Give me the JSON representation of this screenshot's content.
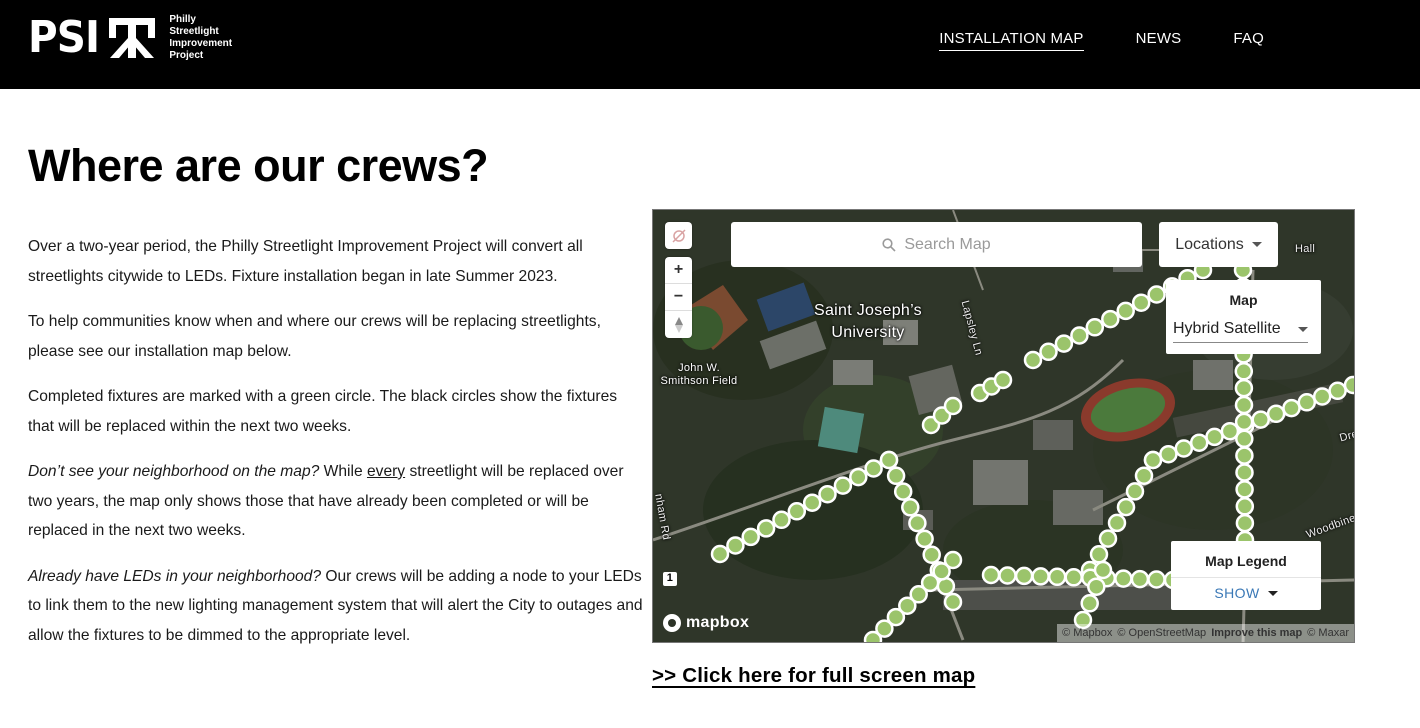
{
  "header": {
    "logo_letters": "PSI",
    "logo_subtitle": [
      "Philly",
      "Streetlight",
      "Improvement",
      "Project"
    ],
    "nav": [
      {
        "label": "INSTALLATION MAP",
        "active": true
      },
      {
        "label": "NEWS",
        "active": false
      },
      {
        "label": "FAQ",
        "active": false
      }
    ]
  },
  "page": {
    "title": "Where are our crews?",
    "paragraphs": {
      "p1": "Over a two-year period, the Philly Streetlight Improvement Project will convert all streetlights citywide to LEDs.  Fixture installation began in late Summer 2023.",
      "p2": "To help communities know when and where our crews will be replacing streetlights, please see our installation map below.",
      "p3": "Completed fixtures are marked with a green circle. The black circles show the fixtures that will be replaced within the next two weeks.",
      "p4_em": "Don’t see your neighborhood on the map?",
      "p4_a": " While ",
      "p4_u": "every",
      "p4_b": " streetlight will be replaced over two years, the map only shows those that have already been completed or will be replaced in the next two weeks.",
      "p5_em": "Already have LEDs in your neighborhood?",
      "p5_b": " Our crews will be adding a node to your LEDs to link them to the new lighting management system that will alert the City to outages and allow the fixtures to be dimmed to the appropriate level."
    },
    "fullscreen_link": ">> Click here for full screen map"
  },
  "map": {
    "search_placeholder": "Search Map",
    "locations_label": "Locations",
    "zoom_in": "+",
    "zoom_out": "−",
    "style_panel_label": "Map",
    "style_selected": "Hybrid Satellite",
    "legend_label": "Map Legend",
    "legend_toggle": "SHOW",
    "mapbox_brand": "mapbox",
    "attribution": {
      "mapbox": "© Mapbox",
      "osm": "© OpenStreetMap",
      "improve": "Improve this map",
      "maxar": "© Maxar"
    },
    "place_labels": {
      "university": "Saint Joseph’s University",
      "field": "John W. Smithson Field",
      "road1": "Lapsley Ln",
      "road2": "Hall",
      "road3": "Dre",
      "road4": "Woodbine",
      "road5": "nham Rd",
      "route": "1"
    },
    "colors": {
      "completed_fixture": "#9bc46b",
      "fixture_stroke": "#ffffff"
    }
  }
}
